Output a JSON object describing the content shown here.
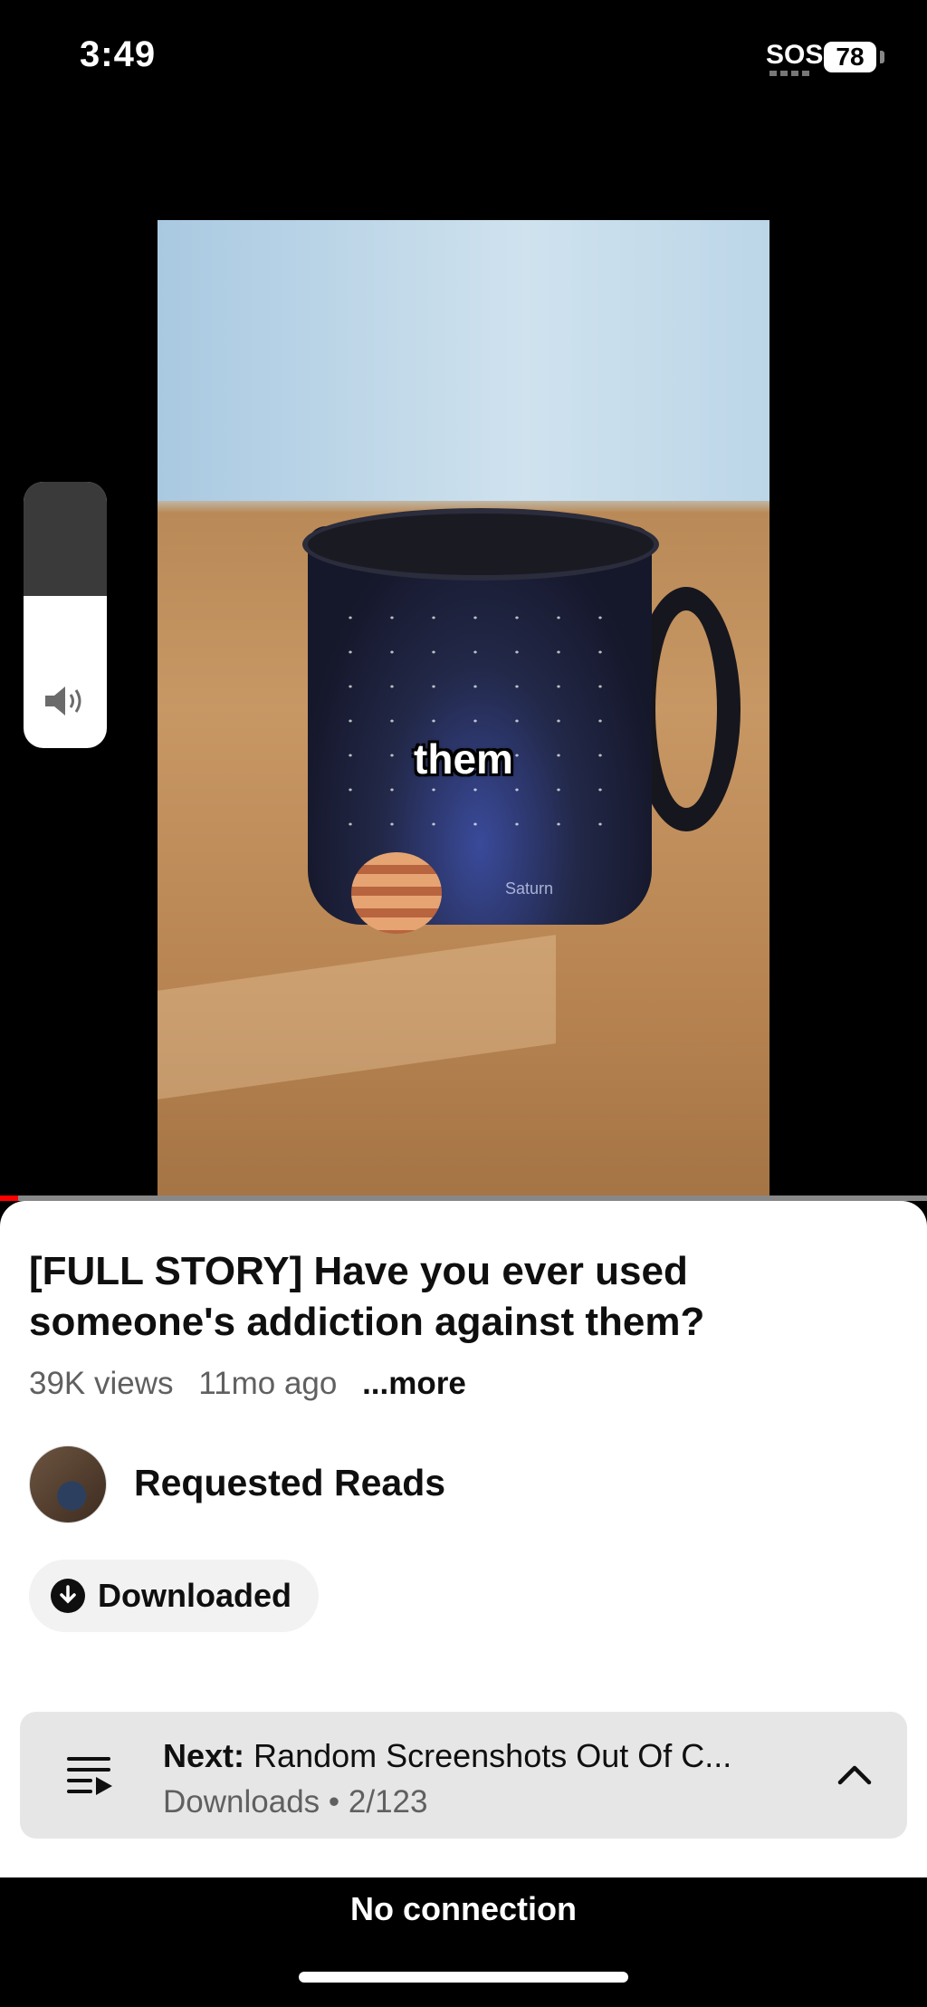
{
  "status_bar": {
    "time": "3:49",
    "sos": "SOS",
    "battery": "78"
  },
  "video": {
    "caption": "them",
    "mug_text": "Saturn",
    "progress": 0.02
  },
  "volume": {
    "level": 0.57
  },
  "details": {
    "title": "[FULL STORY] Have you ever used someone's addiction against them?",
    "views": "39K views",
    "age": "11mo ago",
    "more": "...more",
    "channel": "Requested Reads",
    "download_label": "Downloaded"
  },
  "next_bar": {
    "prefix": "Next:",
    "title": "Random Screenshots Out Of C...",
    "playlist": "Downloads",
    "position": "2/123"
  },
  "banner": {
    "text": "No connection"
  },
  "icons": {
    "volume": "speaker-icon",
    "download": "download-check-icon",
    "queue": "playlist-play-icon",
    "expand": "chevron-up-icon"
  },
  "colors": {
    "progress": "#ff0000",
    "background": "#000000"
  }
}
